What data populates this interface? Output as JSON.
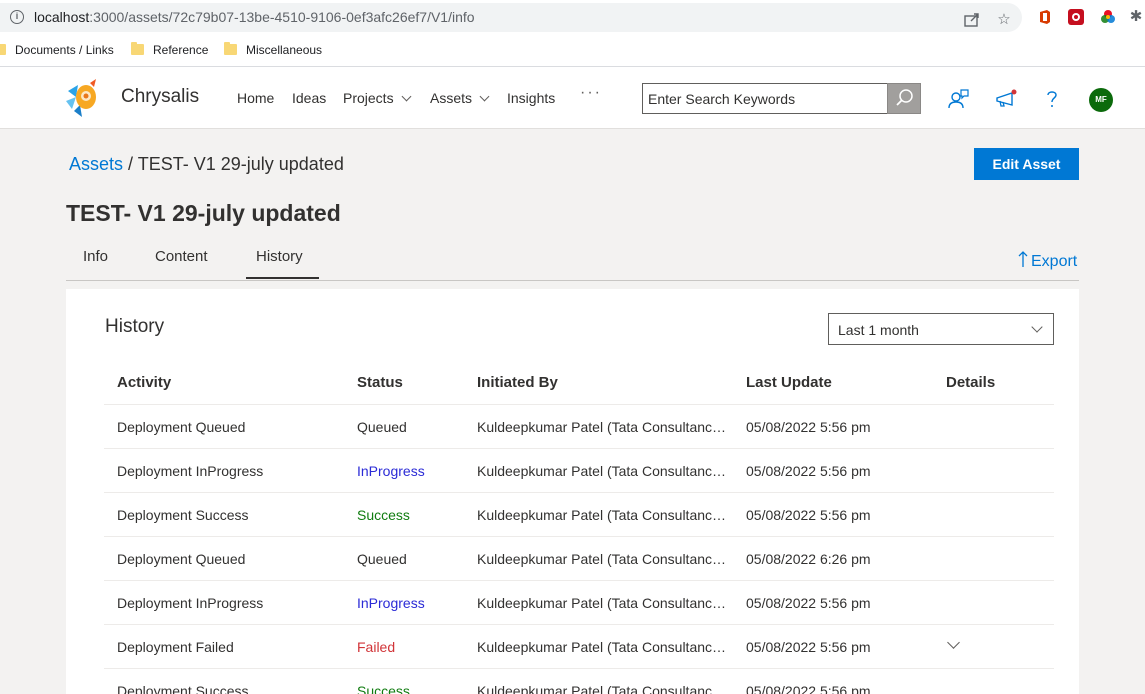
{
  "browser": {
    "url_host": "localhost",
    "url_path": ":3000/assets/72c79b07-13be-4510-9106-0ef3afc26ef7/V1/info",
    "bookmarks": [
      "Documents / Links",
      "Reference",
      "Miscellaneous"
    ]
  },
  "header": {
    "brand": "Chrysalis",
    "nav": [
      {
        "label": "Home"
      },
      {
        "label": "Ideas"
      },
      {
        "label": "Projects"
      },
      {
        "label": "Assets"
      },
      {
        "label": "Insights"
      }
    ],
    "more": "···",
    "search_placeholder": "Enter Search Keywords",
    "avatar_initials": "MF",
    "colors": {
      "accent": "#0078d4",
      "avatar": "#0b6a0b"
    }
  },
  "page": {
    "breadcrumb_root": "Assets",
    "breadcrumb_current": "/ TEST- V1 29-july updated",
    "edit_button": "Edit Asset",
    "title": "TEST- V1 29-july updated",
    "tabs": [
      "Info",
      "Content",
      "History"
    ],
    "active_tab": "History",
    "export_label": "Export"
  },
  "history": {
    "title": "History",
    "filter_value": "Last 1 month",
    "columns": [
      "Activity",
      "Status",
      "Initiated By",
      "Last Update",
      "Details"
    ],
    "rows": [
      {
        "activity": "Deployment Queued",
        "status": "Queued",
        "status_color": "#323130",
        "by": "Kuldeepkumar Patel (Tata Consultancy ...",
        "updated": "05/08/2022 5:56 pm"
      },
      {
        "activity": "Deployment InProgress",
        "status": "InProgress",
        "status_color": "#2b2bd6",
        "by": "Kuldeepkumar Patel (Tata Consultancy ...",
        "updated": "05/08/2022 5:56 pm"
      },
      {
        "activity": "Deployment Success",
        "status": "Success",
        "status_color": "#107c10",
        "by": "Kuldeepkumar Patel (Tata Consultancy ...",
        "updated": "05/08/2022 5:56 pm"
      },
      {
        "activity": "Deployment Queued",
        "status": "Queued",
        "status_color": "#323130",
        "by": "Kuldeepkumar Patel (Tata Consultancy ...",
        "updated": "05/08/2022 6:26 pm"
      },
      {
        "activity": "Deployment InProgress",
        "status": "InProgress",
        "status_color": "#2b2bd6",
        "by": "Kuldeepkumar Patel (Tata Consultancy ...",
        "updated": "05/08/2022 5:56 pm"
      },
      {
        "activity": "Deployment Failed",
        "status": "Failed",
        "status_color": "#d13438",
        "by": "Kuldeepkumar Patel (Tata Consultancy ...",
        "updated": "05/08/2022 5:56 pm",
        "expandable": true
      },
      {
        "activity": "Deployment Success",
        "status": "Success",
        "status_color": "#107c10",
        "by": "Kuldeepkumar Patel (Tata Consultancy ...",
        "updated": "05/08/2022 5:56 pm"
      }
    ]
  }
}
